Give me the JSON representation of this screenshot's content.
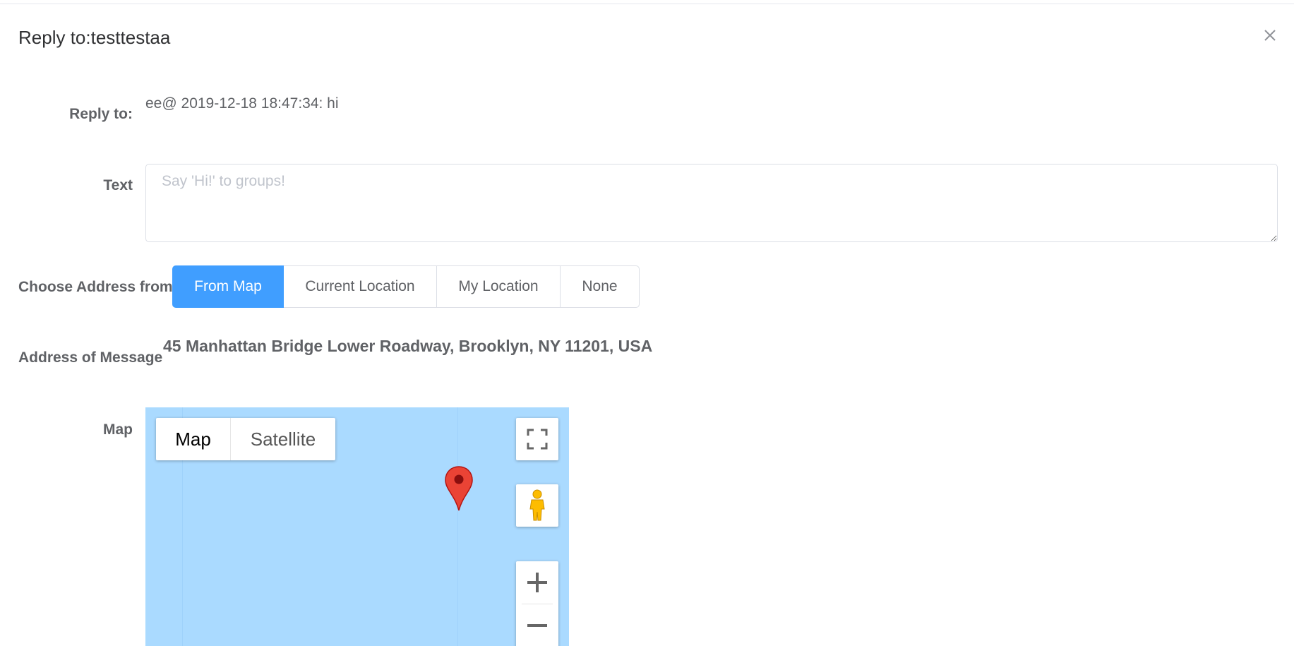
{
  "dialog": {
    "title": "Reply to:testtestaa",
    "close_icon": "close-icon"
  },
  "form": {
    "reply_to": {
      "label": "Reply to:",
      "value": "ee@ 2019-12-18 18:47:34: hi"
    },
    "text": {
      "label": "Text",
      "placeholder": "Say 'Hi!' to groups!",
      "value": ""
    },
    "choose_address": {
      "label": "Choose Address from",
      "options": [
        "From Map",
        "Current Location",
        "My Location",
        "None"
      ],
      "selected": "From Map"
    },
    "address": {
      "label": "Address of Message",
      "value": "45 Manhattan Bridge Lower Roadway, Brooklyn, NY 11201, USA"
    },
    "map": {
      "label": "Map",
      "type_options": [
        "Map",
        "Satellite"
      ],
      "selected_type": "Map",
      "icons": [
        "fullscreen-icon",
        "pegman-icon",
        "zoom-in-icon",
        "zoom-out-icon",
        "map-marker-icon"
      ]
    }
  },
  "colors": {
    "accent": "#409eff",
    "map_water": "#aadaff",
    "marker": "#ea4335"
  }
}
